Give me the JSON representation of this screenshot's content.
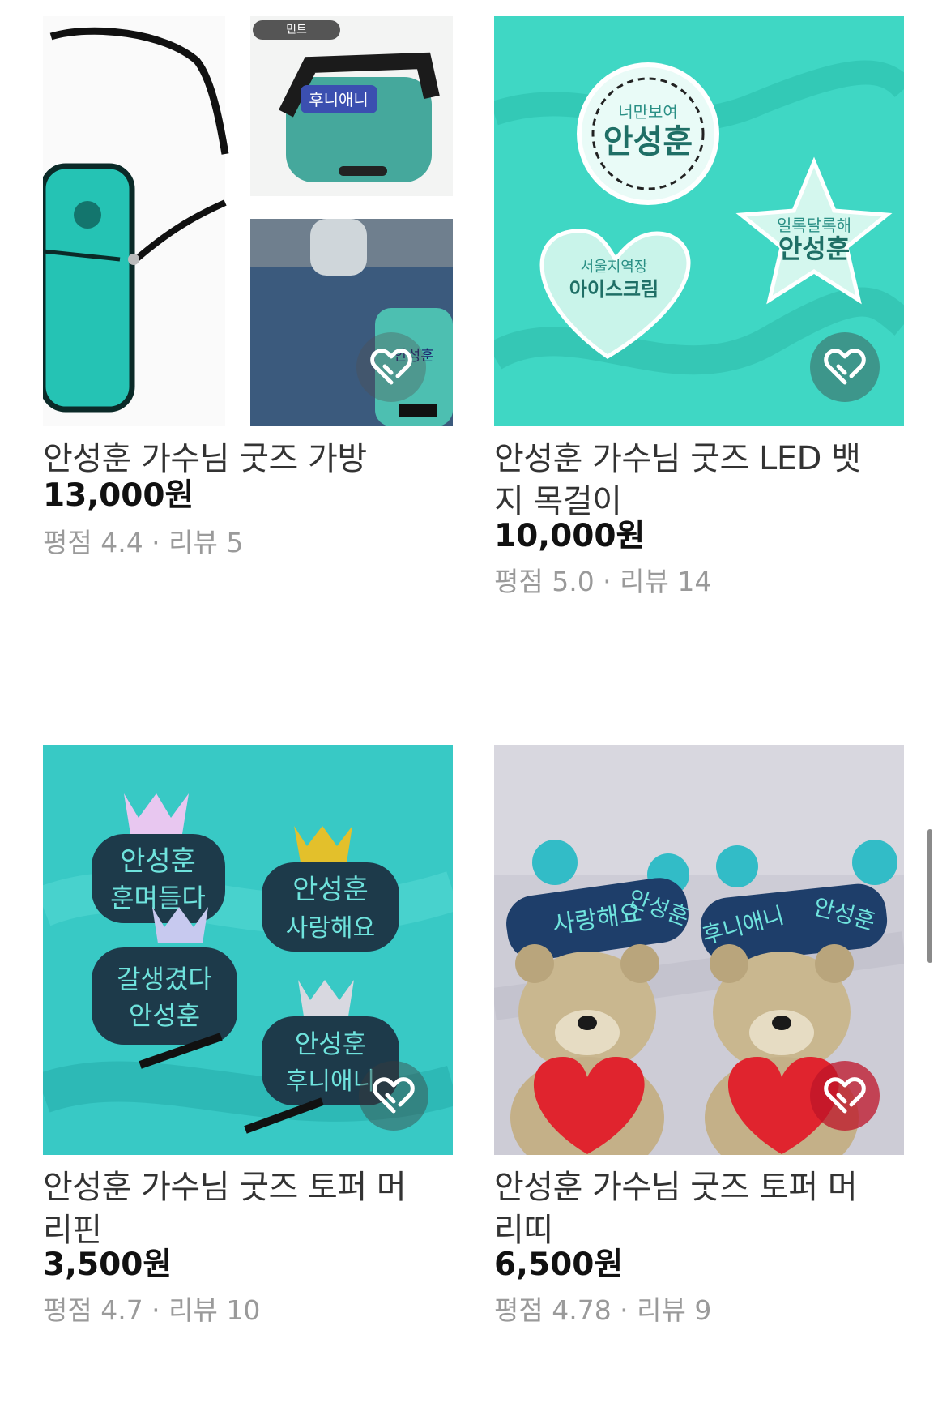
{
  "products": [
    {
      "title": "안성훈 가수님 굿즈 가방",
      "price": "13,000원",
      "rating": "평점 4.4 · 리뷰 5",
      "image_tag": "민트",
      "image_bag_text": "후니애니",
      "image_bag_text2": "안성훈"
    },
    {
      "title": "안성훈 가수님 굿즈 LED 뱃지 목걸이",
      "price": "10,000원",
      "rating": "평점 5.0 · 리뷰 14",
      "image_text": [
        "너만보여",
        "안성훈",
        "일록달록해",
        "안성훈",
        "서울지역장",
        "아이스크림"
      ]
    },
    {
      "title": "안성훈 가수님 굿즈 토퍼 머리핀",
      "price": "3,500원",
      "rating": "평점 4.7 · 리뷰 10",
      "image_text": [
        "안성훈",
        "훈며들다",
        "안성훈",
        "사랑해요",
        "갈생겼다",
        "안성훈",
        "안성훈",
        "후니애니"
      ]
    },
    {
      "title": "안성훈 가수님 굿즈 토퍼 머리띠",
      "price": "6,500원",
      "rating": "평점 4.78 · 리뷰 9",
      "image_text": [
        "사랑해요",
        "안성훈",
        "후니애니",
        "안성훈"
      ]
    }
  ],
  "icons": {
    "wishlist": "heart-link-icon",
    "brand_teal": "#3fd9c6",
    "wish_active": "#be1428"
  }
}
